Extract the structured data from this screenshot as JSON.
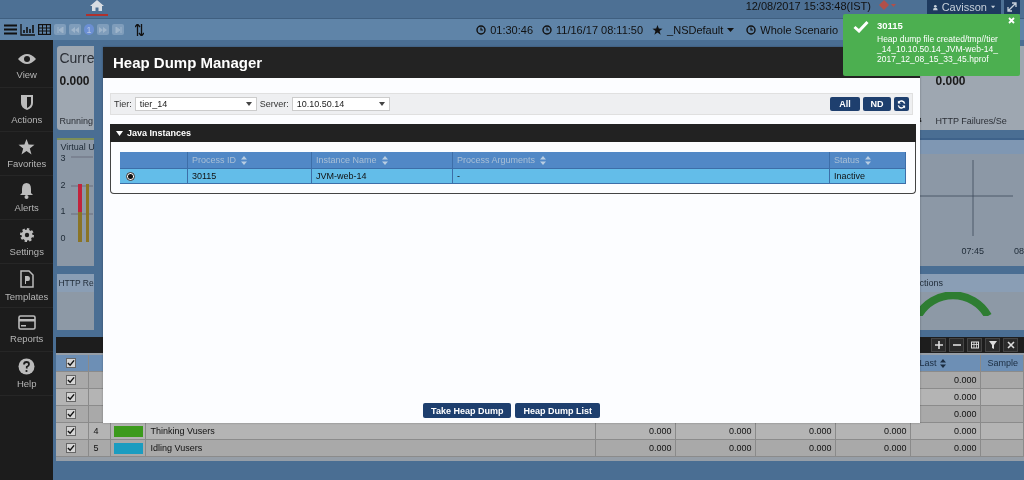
{
  "top_bar": {
    "datetime": "12/08/2017 15:33:48(IST)",
    "user": "Cavisson"
  },
  "toolbar": {
    "page": "1",
    "elapsed": "01:30:46",
    "start": "11/16/17 08:11:50",
    "favorite": "_NSDefault",
    "scope": "Whole Scenario"
  },
  "sidebar": {
    "items": [
      {
        "label": "View"
      },
      {
        "label": "Actions"
      },
      {
        "label": "Favorites"
      },
      {
        "label": "Alerts"
      },
      {
        "label": "Settings"
      },
      {
        "label": "Templates"
      },
      {
        "label": "Reports"
      },
      {
        "label": "Help"
      }
    ]
  },
  "dashboard": {
    "current_card": {
      "title": "Curre",
      "value": "0.000",
      "footer": "Running"
    },
    "vusers_chart": {
      "title": "Virtual U",
      "yticks": [
        "3",
        "2",
        "1",
        "0"
      ]
    },
    "http_card": {
      "title": "HTTP Re"
    },
    "failures_card": {
      "value": "0.000",
      "title": "HTTP Failures/Se"
    },
    "time_chart": {
      "ticks": [
        "07:45",
        "08"
      ]
    },
    "transactions_card": {
      "title": "ctions"
    }
  },
  "metrics_table": {
    "all_checked": true,
    "columns": [
      "Last",
      "Sample"
    ],
    "rows": [
      {
        "checked": true,
        "values": [
          "0.000"
        ]
      },
      {
        "checked": true,
        "values": [
          "0.000"
        ]
      },
      {
        "checked": true,
        "values": [
          "0.000"
        ]
      },
      {
        "checked": true,
        "number": "4",
        "color": "#3c9a1c",
        "name": "Thinking Vusers",
        "values": [
          "0.000",
          "0.000",
          "0.000",
          "0.000",
          "0.000"
        ]
      },
      {
        "checked": true,
        "number": "5",
        "color": "#1a9cc0",
        "name": "Idling Vusers",
        "values": [
          "0.000",
          "0.000",
          "0.000",
          "0.000",
          "0.000"
        ]
      }
    ]
  },
  "dialog": {
    "title": "Heap Dump Manager",
    "tier_label": "Tier:",
    "tier": "tier_14",
    "server_label": "Server:",
    "server": "10.10.50.14",
    "buttons": [
      "All",
      "ND"
    ],
    "section": {
      "title": "Java Instances",
      "expanded": true
    },
    "columns": [
      "Process ID",
      "Instance Name",
      "Process Arguments",
      "Status"
    ],
    "rows": [
      {
        "selected": true,
        "process_id": "30115",
        "instance_name": "JVM-web-14",
        "process_arguments": "-",
        "status": "Inactive"
      }
    ],
    "actions": [
      "Take Heap Dump",
      "Heap Dump List"
    ]
  },
  "toast": {
    "title": "30115",
    "message": "Heap dump file created/tmp//tier_14_10.10.50.14_JVM-web-14_2017_12_08_15_33_45.hprof"
  }
}
